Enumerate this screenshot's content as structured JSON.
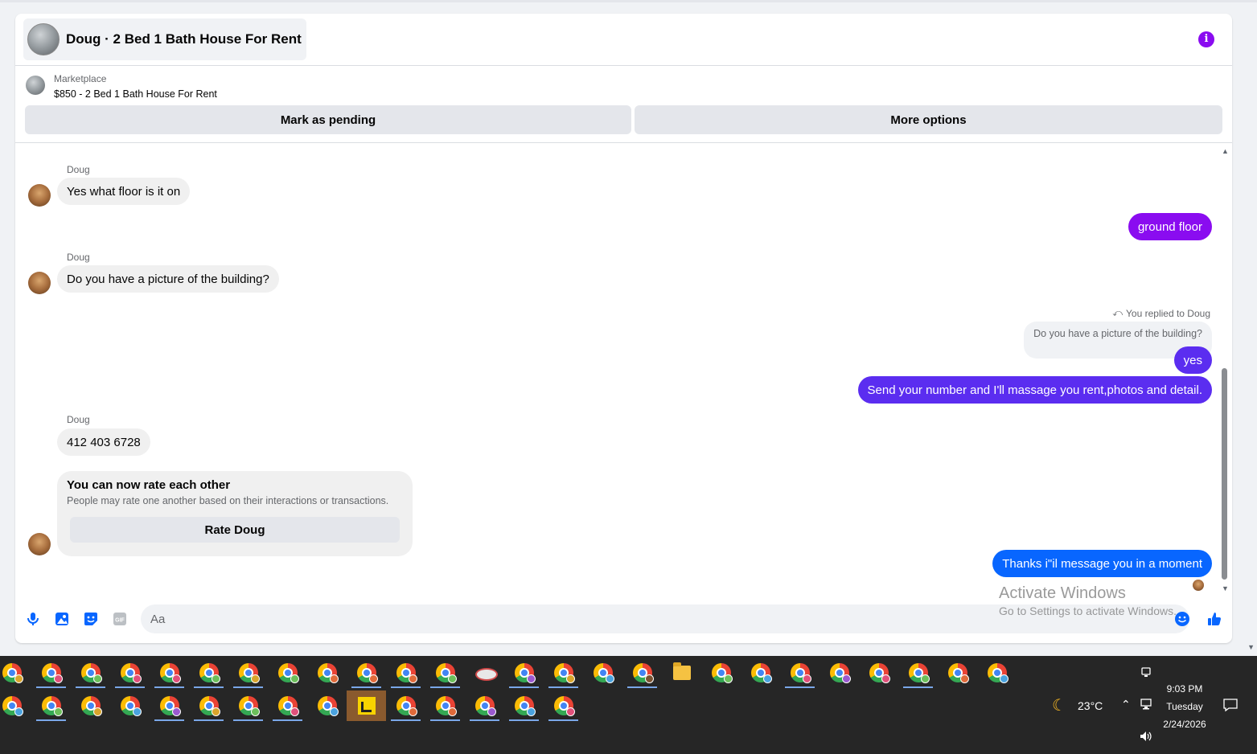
{
  "header": {
    "title": "Doug · 2 Bed 1 Bath House For Rent"
  },
  "listing": {
    "label": "Marketplace",
    "title": "$850 - 2 Bed 1 Bath House For Rent",
    "mark_pending_label": "Mark as pending",
    "more_options_label": "More options"
  },
  "messages": {
    "msg1": {
      "sender": "Doug",
      "text": "Yes what floor is it on"
    },
    "msg2": {
      "text": "ground floor",
      "color": "#8a0cf0"
    },
    "msg3": {
      "sender": "Doug",
      "text": "Do you have a picture of the building?"
    },
    "reply_label": "You replied to Doug",
    "reply_quote": "Do you have a picture of the building?",
    "msg4": {
      "text": "yes",
      "color": "#5b2df0"
    },
    "msg5": {
      "text": "Send your number and I'll massage you rent,photos and detail.",
      "color": "#5b2df0"
    },
    "msg6": {
      "sender": "Doug",
      "text": "412 403 6728"
    },
    "rating_card": {
      "title": "You can now rate each other",
      "subtitle": "People may rate one another based on their interactions or transactions.",
      "button_label": "Rate Doug"
    },
    "msg7": {
      "text": "Thanks i\"il message you in a moment",
      "color": "#0866ff"
    }
  },
  "composer": {
    "placeholder": "Aa",
    "icons": [
      "microphone-icon",
      "image-icon",
      "sticker-icon",
      "gif-icon",
      "emoji-icon",
      "like-icon"
    ],
    "gif_label": "GIF",
    "accent": "#0866ff"
  },
  "watermark": {
    "line1": "Activate Windows",
    "line2": "Go to Settings to activate Windows."
  },
  "taskbar": {
    "weather": "23°C",
    "time": "9:03 PM",
    "day": "Tuesday",
    "date": "2/24/2026"
  }
}
